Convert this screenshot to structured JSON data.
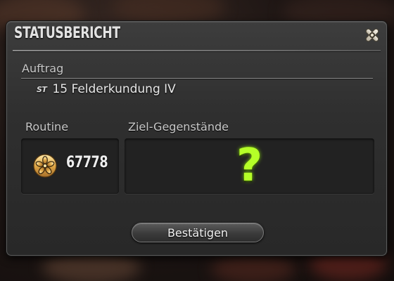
{
  "window": {
    "title": "STATUSBERICHT",
    "close_icon": "close-x-icon"
  },
  "duty": {
    "section_label": "Auftrag",
    "tag": "ST",
    "name": "15 Felderkundung IV"
  },
  "routine": {
    "label": "Routine",
    "icon": "seal-emblem-icon",
    "value": "67778"
  },
  "targets": {
    "label": "Ziel-Gegenstände",
    "placeholder": "?",
    "placeholder_color": "#b5ff28"
  },
  "actions": {
    "confirm_label": "Bestätigen"
  }
}
